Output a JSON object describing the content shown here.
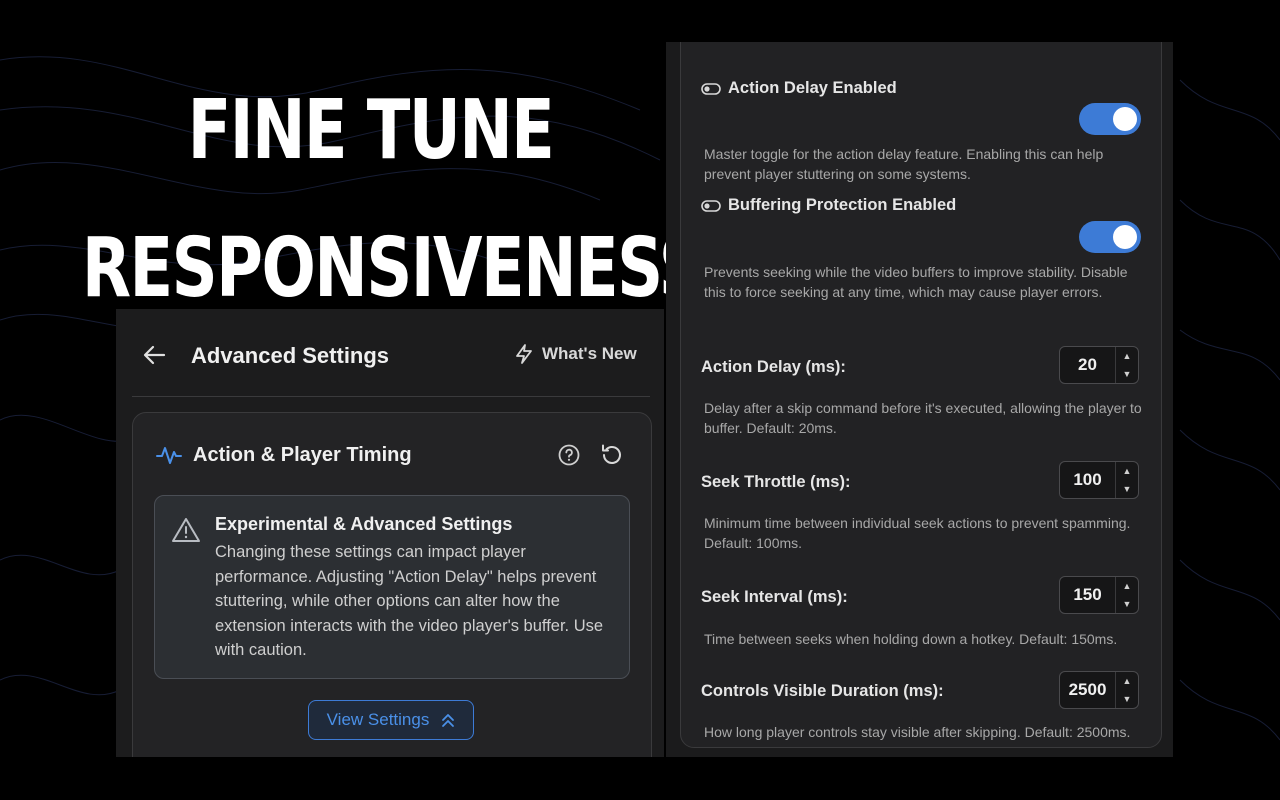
{
  "headline": {
    "line1": "FINE TUNE",
    "line2": "RESPONSIVENESS"
  },
  "left_panel": {
    "title": "Advanced Settings",
    "whats_new_label": "What's New",
    "card": {
      "title": "Action & Player Timing",
      "warning": {
        "title": "Experimental & Advanced Settings",
        "body": "Changing these settings can impact player performance. Adjusting \"Action Delay\" helps prevent stuttering, while other options can alter how the extension interacts with the video player's buffer. Use with caution."
      },
      "view_button_label": "View Settings"
    }
  },
  "settings": {
    "action_delay_enabled": {
      "label": "Action Delay Enabled",
      "desc": "Master toggle for the action delay feature. Enabling this can help prevent player stuttering on some systems.",
      "on": true
    },
    "buffering_protection": {
      "label": "Buffering Protection Enabled",
      "desc": "Prevents seeking while the video buffers to improve stability. Disable this to force seeking at any time, which may cause player errors.",
      "on": true
    },
    "action_delay": {
      "label": "Action Delay (ms):",
      "value": "20",
      "desc": "Delay after a skip command before it's executed, allowing the player to buffer. Default: 20ms."
    },
    "seek_throttle": {
      "label": "Seek Throttle (ms):",
      "value": "100",
      "desc": "Minimum time between individual seek actions to prevent spamming. Default: 100ms."
    },
    "seek_interval": {
      "label": "Seek Interval (ms):",
      "value": "150",
      "desc": "Time between seeks when holding down a hotkey. Default: 150ms."
    },
    "controls_visible": {
      "label": "Controls Visible Duration (ms):",
      "value": "2500",
      "desc": "How long player controls stay visible after skipping. Default: 2500ms."
    }
  },
  "colors": {
    "accent": "#3d7bd6",
    "background": "#000000",
    "panel": "#1c1c1d"
  },
  "icons": [
    "back-arrow-icon",
    "lightning-icon",
    "pulse-icon",
    "help-circle-icon",
    "reset-icon",
    "warning-triangle-icon",
    "chevrons-up-icon",
    "toggle-icon",
    "stepper-up-icon",
    "stepper-down-icon"
  ]
}
